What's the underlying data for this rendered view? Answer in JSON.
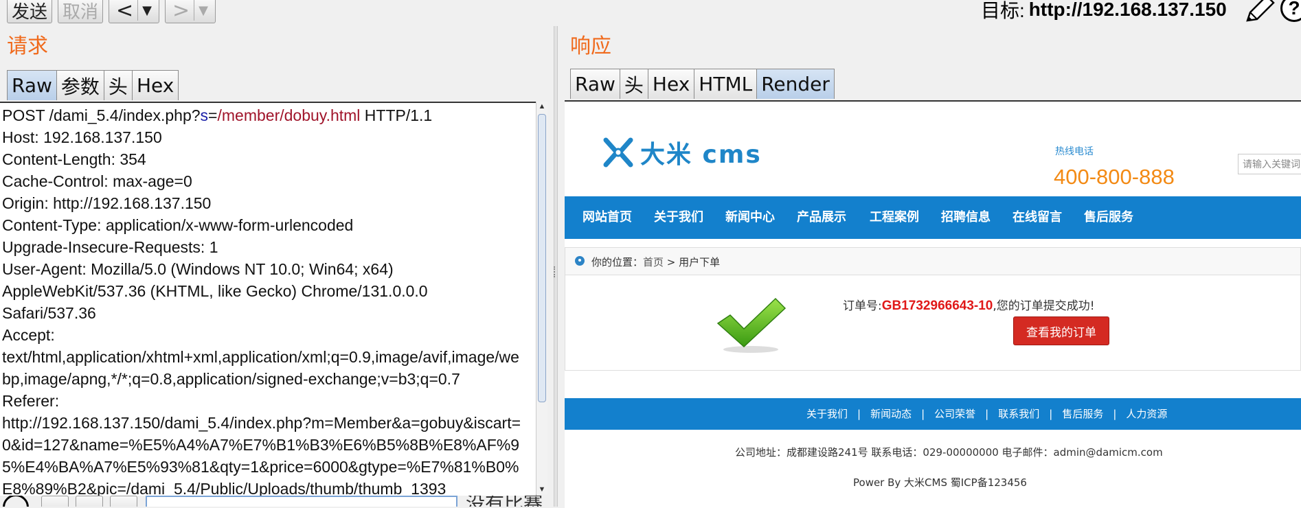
{
  "toolbar": {
    "send_label": "发送",
    "cancel_label": "取消",
    "back_label": "<",
    "forward_label": ">",
    "dropdown_glyph": "▼",
    "target_label": "目标:",
    "target_url": "http://192.168.137.150",
    "help_glyph": "?"
  },
  "request": {
    "title": "请求",
    "tabs": [
      "Raw",
      "参数",
      "头",
      "Hex"
    ],
    "active_tab": "Raw",
    "line1_pre": "POST /dami_5.4/index.php?",
    "line1_key": "s",
    "line1_eq": "=",
    "line1_val": "/member/dobuy.html",
    "line1_post": " HTTP/1.1",
    "body": "Host: 192.168.137.150\nContent-Length: 354\nCache-Control: max-age=0\nOrigin: http://192.168.137.150\nContent-Type: application/x-www-form-urlencoded\nUpgrade-Insecure-Requests: 1\nUser-Agent: Mozilla/5.0 (Windows NT 10.0; Win64; x64)\nAppleWebKit/537.36 (KHTML, like Gecko) Chrome/131.0.0.0\nSafari/537.36\nAccept:\ntext/html,application/xhtml+xml,application/xml;q=0.9,image/avif,image/webp,image/apng,*/*;q=0.8,application/signed-exchange;v=b3;q=0.7\nReferer:\nhttp://192.168.137.150/dami_5.4/index.php?m=Member&a=gobuy&iscart=0&id=127&name=%E5%A4%A7%E7%B1%B3%E6%B5%8B%E8%AF%95%E4%BA%A7%E5%93%81&qty=1&price=6000&gtype=%E7%81%B0%E8%89%B2&pic=/dami_5.4/Public/Uploads/thumb/thumb_1393",
    "bottom_status": "没有比赛"
  },
  "response": {
    "title": "响应",
    "tabs": [
      "Raw",
      "头",
      "Hex",
      "HTML",
      "Render"
    ],
    "active_tab": "Render",
    "site": {
      "logo_text": "大米 cms",
      "hotline_label": "热线电话",
      "hotline_number": "400-800-888",
      "search_placeholder": "请输入关键词",
      "nav": [
        "网站首页",
        "关于我们",
        "新闻中心",
        "产品展示",
        "工程案例",
        "招聘信息",
        "在线留言",
        "售后服务"
      ],
      "crumb_prefix": "你的位置：",
      "crumb_home": "首页",
      "crumb_sep": " > ",
      "crumb_current": "用户下单",
      "order_prefix": "订单号:",
      "order_number": "GB1732966643-10",
      "order_suffix": ",您的订单提交成功!",
      "view_orders_label": "查看我的订单",
      "footer_links": [
        "关于我们",
        "新闻动态",
        "公司荣誉",
        "联系我们",
        "售后服务",
        "人力资源"
      ],
      "footer_address": "公司地址：成都建设路241号 联系电话：029-00000000 电子邮件：admin@damicm.com",
      "footer_power": "Power By 大米CMS  蜀ICP备123456"
    }
  },
  "colors": {
    "panel_title": "#f06a1c",
    "nav_blue": "#1380cd",
    "order_red": "#e01818",
    "hotline_orange": "#f38a14"
  }
}
